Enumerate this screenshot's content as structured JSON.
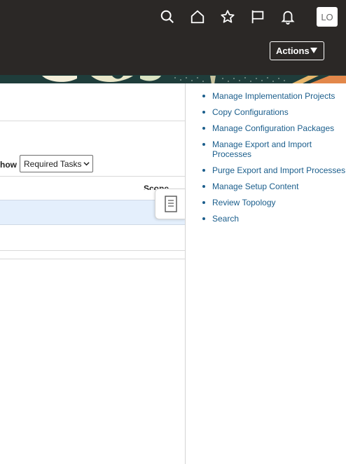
{
  "header": {
    "icons": [
      "search-icon",
      "home-icon",
      "star-icon",
      "flag-icon",
      "bell-icon"
    ],
    "avatar_initials": "LO",
    "actions_label": "Actions"
  },
  "content": {
    "show_label": "how",
    "show_select_value": "Required Tasks",
    "scope_header": "Scope"
  },
  "tasks": [
    "Manage Implementation Projects",
    "Copy Configurations",
    "Manage Configuration Packages",
    "Manage Export and Import Processes",
    "Purge Export and Import Processes",
    "Manage Setup Content",
    "Review Topology",
    "Search"
  ],
  "colors": {
    "header_bg": "#2b2826",
    "link": "#1b5e8c",
    "selected_row": "#e4effc"
  }
}
